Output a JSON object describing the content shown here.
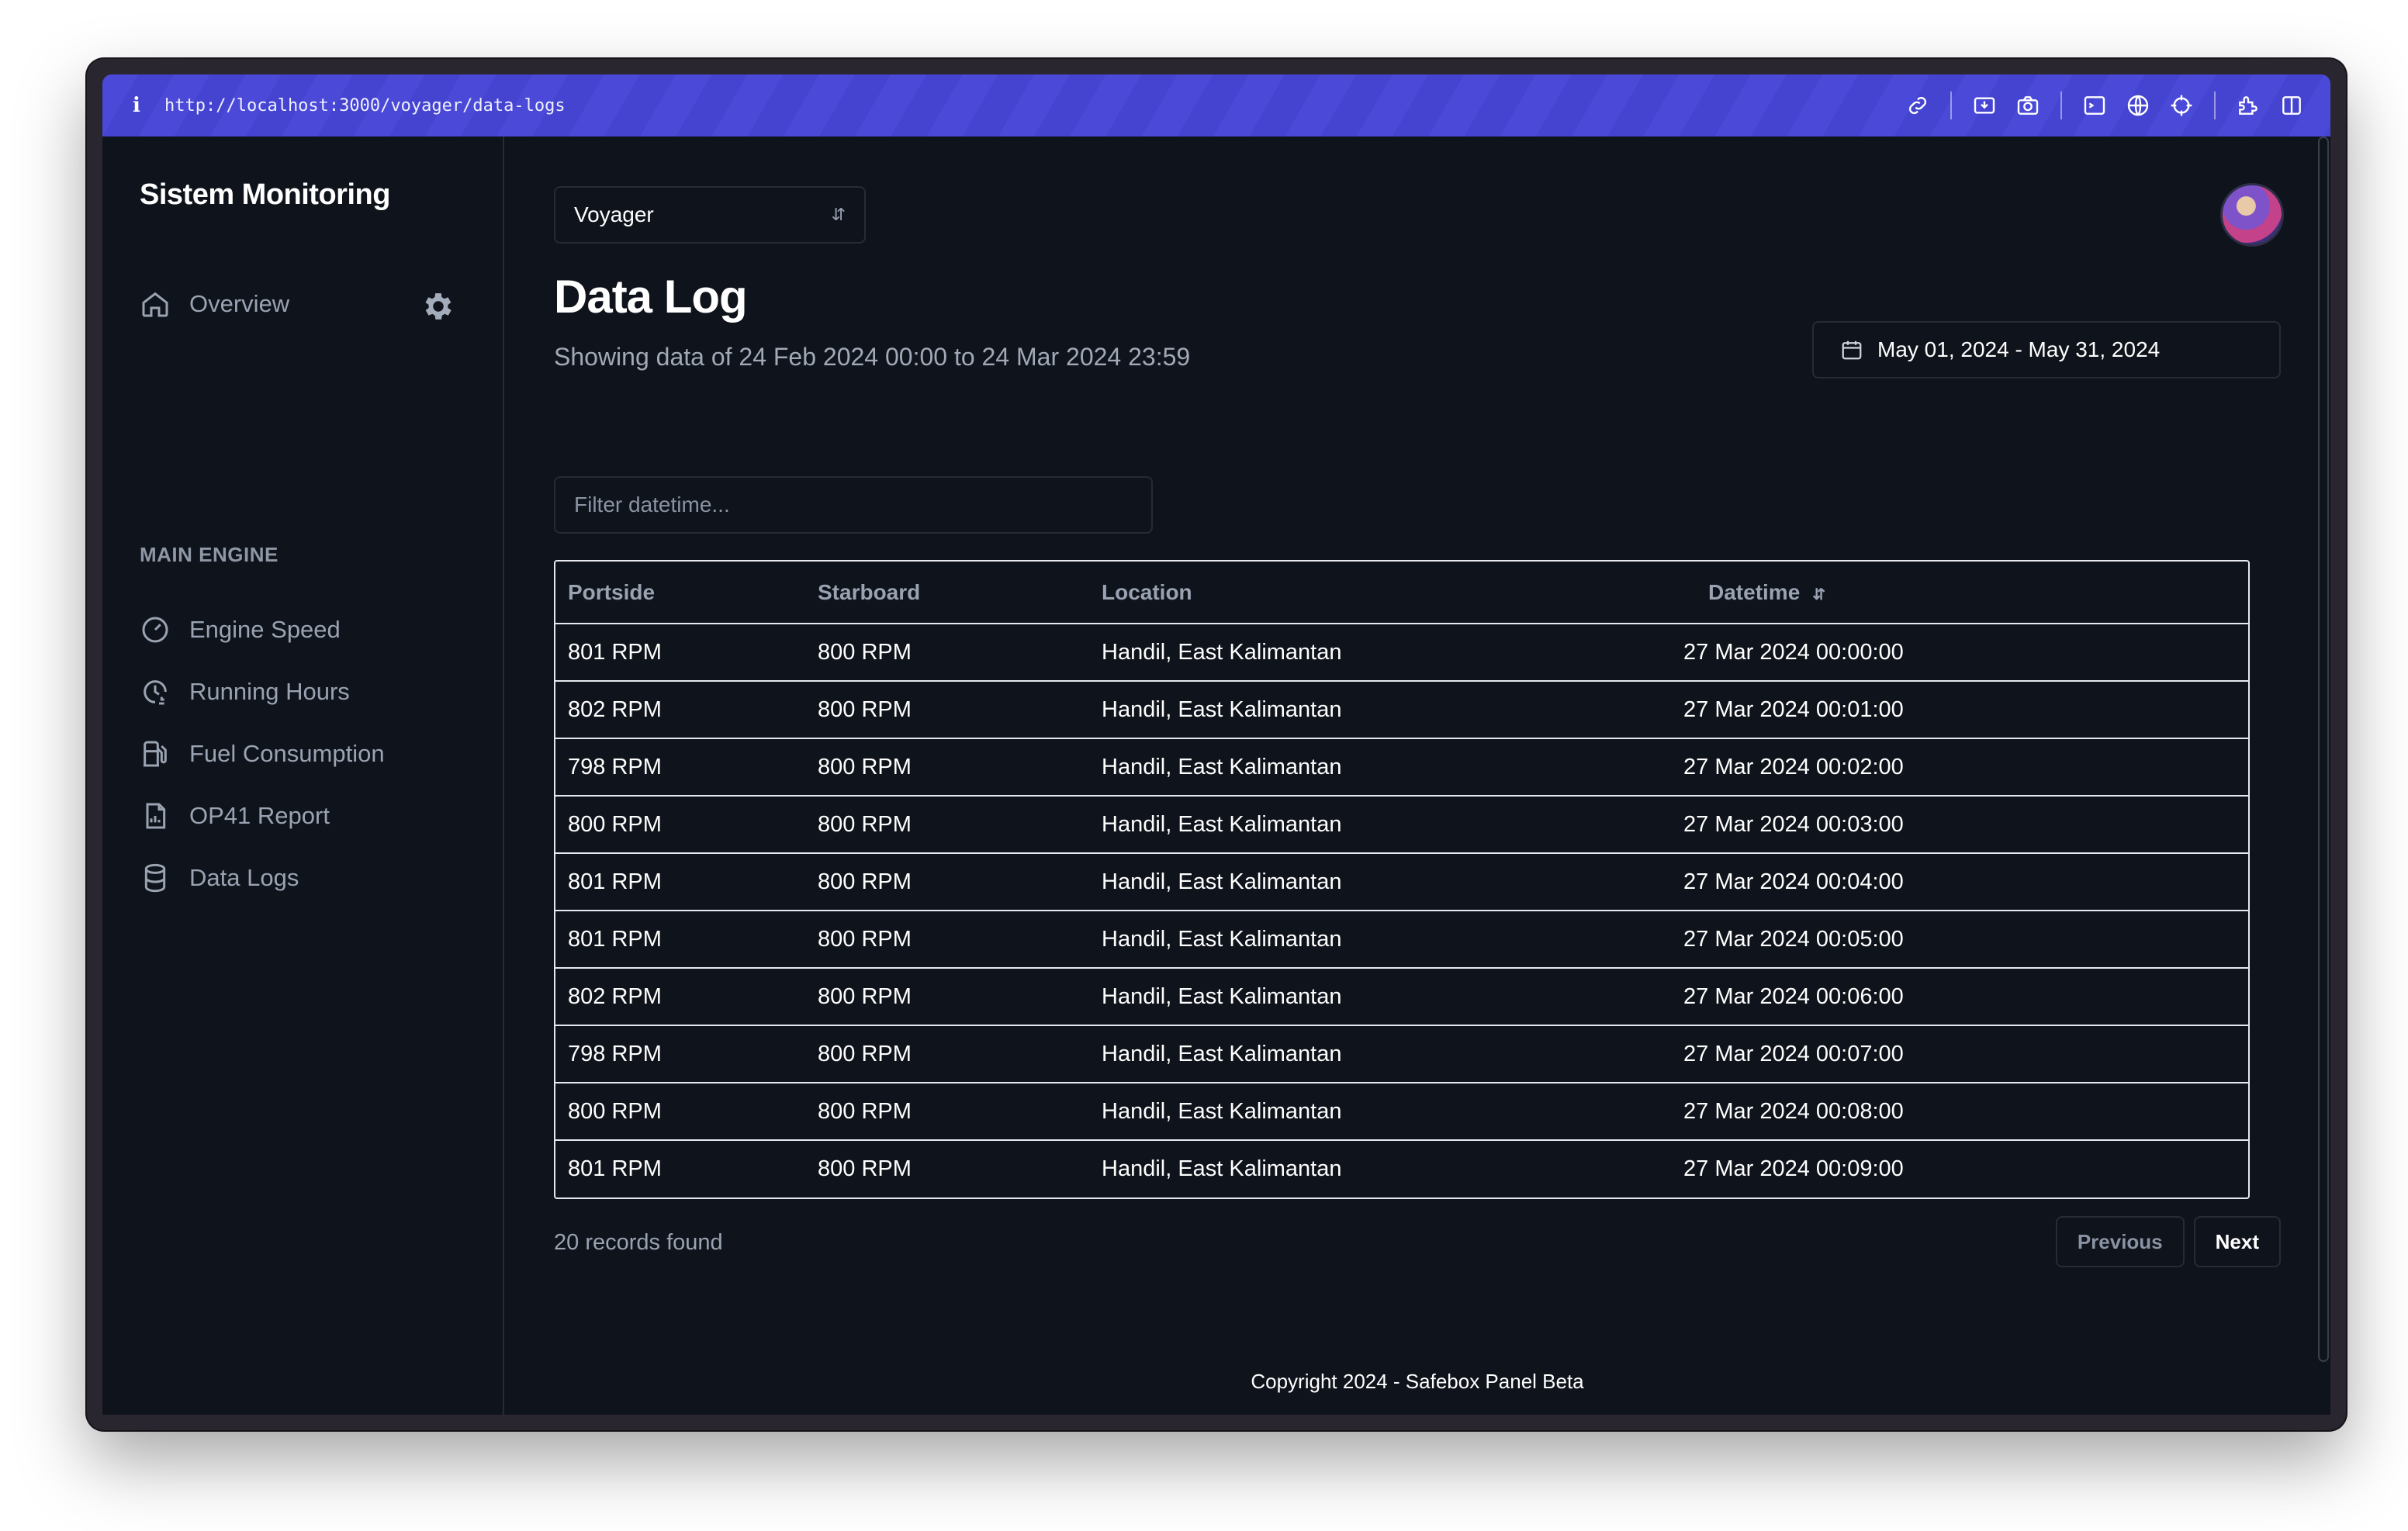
{
  "browser": {
    "url": "http://localhost:3000/voyager/data-logs"
  },
  "sidebar": {
    "brand": "Sistem Monitoring",
    "overview": "Overview",
    "section_label": "MAIN ENGINE",
    "items": [
      {
        "label": "Engine Speed",
        "icon": "gauge-icon"
      },
      {
        "label": "Running Hours",
        "icon": "clock-icon"
      },
      {
        "label": "Fuel Consumption",
        "icon": "fuel-icon"
      },
      {
        "label": "OP41 Report",
        "icon": "report-icon"
      },
      {
        "label": "Data Logs",
        "icon": "database-icon"
      }
    ]
  },
  "header": {
    "vessel_select": "Voyager",
    "title": "Data Log",
    "subtitle": "Showing data of 24 Feb 2024 00:00 to 24 Mar 2024 23:59",
    "date_range": "May 01, 2024 - May 31, 2024"
  },
  "filter": {
    "placeholder": "Filter datetime..."
  },
  "table": {
    "columns": [
      "Portside",
      "Starboard",
      "Location",
      "Datetime"
    ],
    "rows": [
      [
        "801 RPM",
        "800 RPM",
        "Handil, East Kalimantan",
        "27 Mar 2024 00:00:00"
      ],
      [
        "802 RPM",
        "800 RPM",
        "Handil, East Kalimantan",
        "27 Mar 2024 00:01:00"
      ],
      [
        "798 RPM",
        "800 RPM",
        "Handil, East Kalimantan",
        "27 Mar 2024 00:02:00"
      ],
      [
        "800 RPM",
        "800 RPM",
        "Handil, East Kalimantan",
        "27 Mar 2024 00:03:00"
      ],
      [
        "801 RPM",
        "800 RPM",
        "Handil, East Kalimantan",
        "27 Mar 2024 00:04:00"
      ],
      [
        "801 RPM",
        "800 RPM",
        "Handil, East Kalimantan",
        "27 Mar 2024 00:05:00"
      ],
      [
        "802 RPM",
        "800 RPM",
        "Handil, East Kalimantan",
        "27 Mar 2024 00:06:00"
      ],
      [
        "798 RPM",
        "800 RPM",
        "Handil, East Kalimantan",
        "27 Mar 2024 00:07:00"
      ],
      [
        "800 RPM",
        "800 RPM",
        "Handil, East Kalimantan",
        "27 Mar 2024 00:08:00"
      ],
      [
        "801 RPM",
        "800 RPM",
        "Handil, East Kalimantan",
        "27 Mar 2024 00:09:00"
      ]
    ]
  },
  "pagination": {
    "records_found": "20 records found",
    "previous": "Previous",
    "next": "Next"
  },
  "footer": {
    "copyright": "Copyright 2024 - Safebox Panel Beta"
  },
  "colors": {
    "topbar": "#4a49d8",
    "background": "#0f131b",
    "table_border": "#e7e9ee",
    "muted_text": "#9aa3b2"
  }
}
